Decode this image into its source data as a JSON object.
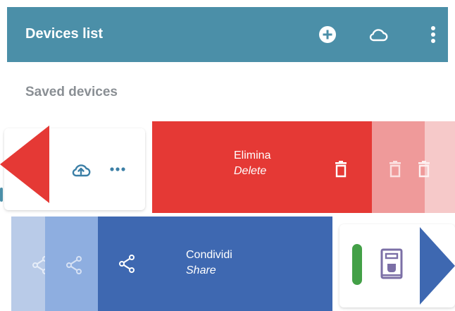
{
  "app_bar": {
    "title": "Devices list",
    "actions": [
      "add-icon",
      "cloud-icon",
      "more-vert-icon"
    ],
    "color": "#4b8fa8"
  },
  "section": {
    "title": "Saved devices"
  },
  "swipe_delete": {
    "label": "Elimina",
    "translation": "Delete",
    "icon": "trash-icon",
    "color": "#e53935"
  },
  "swipe_share": {
    "label": "Condividi",
    "translation": "Share",
    "icon": "share-icon",
    "color": "#3e68b1"
  },
  "device_left": {
    "icons": [
      "cloud-upload-icon",
      "more-horiz-icon"
    ]
  },
  "device_right": {
    "icons": [
      "status-indicator",
      "coffee-machine-icon"
    ],
    "status_color": "#43a047"
  },
  "indicators": {
    "swipe_left_arrow_color": "#e53935",
    "swipe_right_arrow_color": "#3e68b1"
  }
}
